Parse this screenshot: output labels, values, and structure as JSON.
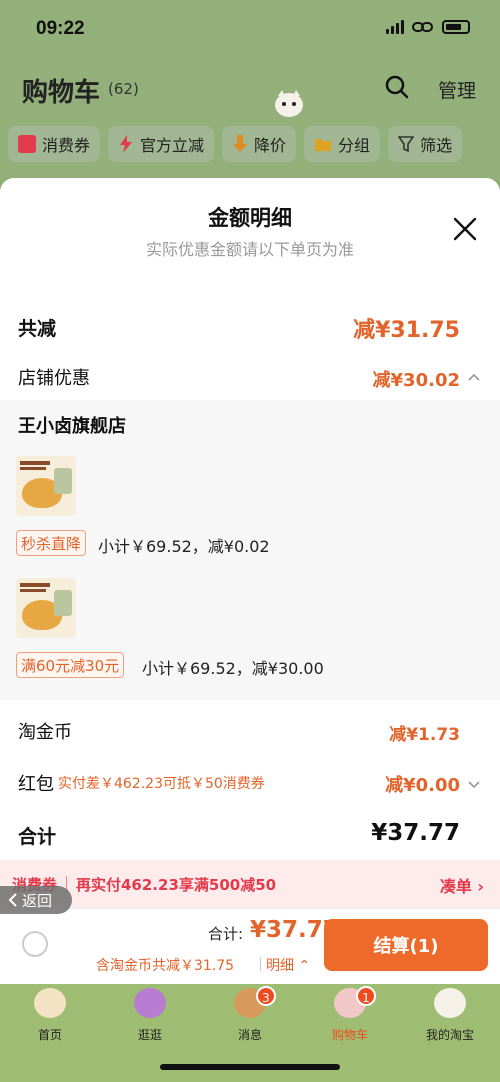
{
  "status_bar": {
    "time": "09:22"
  },
  "cart_header": {
    "title": "购物车",
    "count": "(62)",
    "manage": "管理"
  },
  "filters": [
    {
      "label": "消费券",
      "color": "#e23a4c"
    },
    {
      "label": "官方立减",
      "color": "#e23a4c"
    },
    {
      "label": "降价",
      "color": "#e08a20"
    },
    {
      "label": "分组",
      "color": "#e0a020"
    },
    {
      "label": "筛选",
      "color": "#333333"
    }
  ],
  "sheet": {
    "title": "金额明细",
    "subtitle": "实际优惠金额请以下单页为准",
    "total_discount": {
      "label": "共减",
      "value": "减¥31.75"
    },
    "store_discount": {
      "label": "店铺优惠",
      "value": "减¥30.02"
    },
    "store": {
      "name": "王小卤旗舰店",
      "items": [
        {
          "tag": "秒杀直降",
          "detail": "小计￥69.52，减¥0.02"
        },
        {
          "tag": "满60元减30元",
          "detail": "小计￥69.52，减¥30.00"
        }
      ]
    },
    "gold_coin": {
      "label": "淘金币",
      "value": "减¥1.73"
    },
    "red_packet": {
      "label": "红包",
      "hint": "实付差￥462.23可抵￥50消费券",
      "value": "减¥0.00"
    },
    "sum": {
      "label": "合计",
      "value": "¥37.77"
    }
  },
  "coupon_banner": {
    "tag": "消费券",
    "text": "再实付462.23享满500减50",
    "action": "凑单 ›"
  },
  "back": {
    "label": "返回"
  },
  "checkout": {
    "total_label": "合计:",
    "total_value": "¥37.77",
    "sub": "含淘金币共减￥31.75",
    "detail": "明细 ⌃",
    "button": "结算(1)"
  },
  "tabs": [
    {
      "label": "首页",
      "badge": ""
    },
    {
      "label": "逛逛",
      "badge": ""
    },
    {
      "label": "消息",
      "badge": "3"
    },
    {
      "label": "购物车",
      "badge": "1"
    },
    {
      "label": "我的淘宝",
      "badge": ""
    }
  ],
  "colors": {
    "accent": "#e3642b",
    "button": "#ee6a2a",
    "coupon": "#e23a4c",
    "background": "#9ebd72"
  }
}
